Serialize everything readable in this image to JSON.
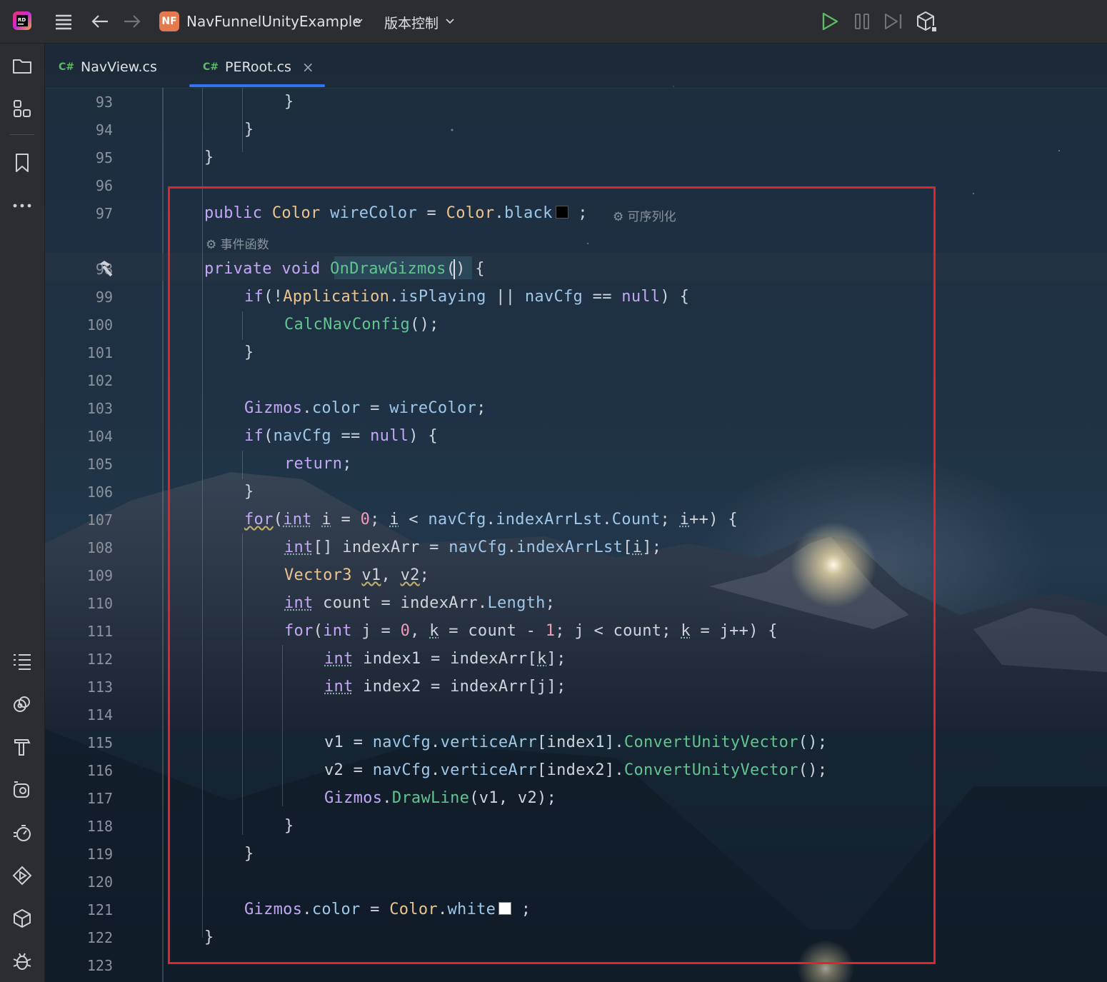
{
  "titlebar": {
    "project_badge": "NF",
    "project_name": "NavFunnelUnityExample",
    "vcs_label": "版本控制"
  },
  "tabs": [
    {
      "label": "NavView.cs",
      "lang": "C#",
      "active": false
    },
    {
      "label": "PERoot.cs",
      "lang": "C#",
      "active": true,
      "close": "×"
    }
  ],
  "hints": {
    "serializable": "可序列化",
    "event_function": "事件函数"
  },
  "lines": {
    "n93": "93",
    "n94": "94",
    "n95": "95",
    "n96": "96",
    "n97": "97",
    "n98": "98",
    "n99": "99",
    "n100": "100",
    "n101": "101",
    "n102": "102",
    "n103": "103",
    "n104": "104",
    "n105": "105",
    "n106": "106",
    "n107": "107",
    "n108": "108",
    "n109": "109",
    "n110": "110",
    "n111": "111",
    "n112": "112",
    "n113": "113",
    "n114": "114",
    "n115": "115",
    "n116": "116",
    "n117": "117",
    "n118": "118",
    "n119": "119",
    "n120": "120",
    "n121": "121",
    "n122": "122",
    "n123": "123"
  },
  "colors": {
    "accent": "#3574f0",
    "highlight_box": "#e0242c",
    "wire_color_swatch": "#000000",
    "white_swatch": "#ffffff"
  }
}
